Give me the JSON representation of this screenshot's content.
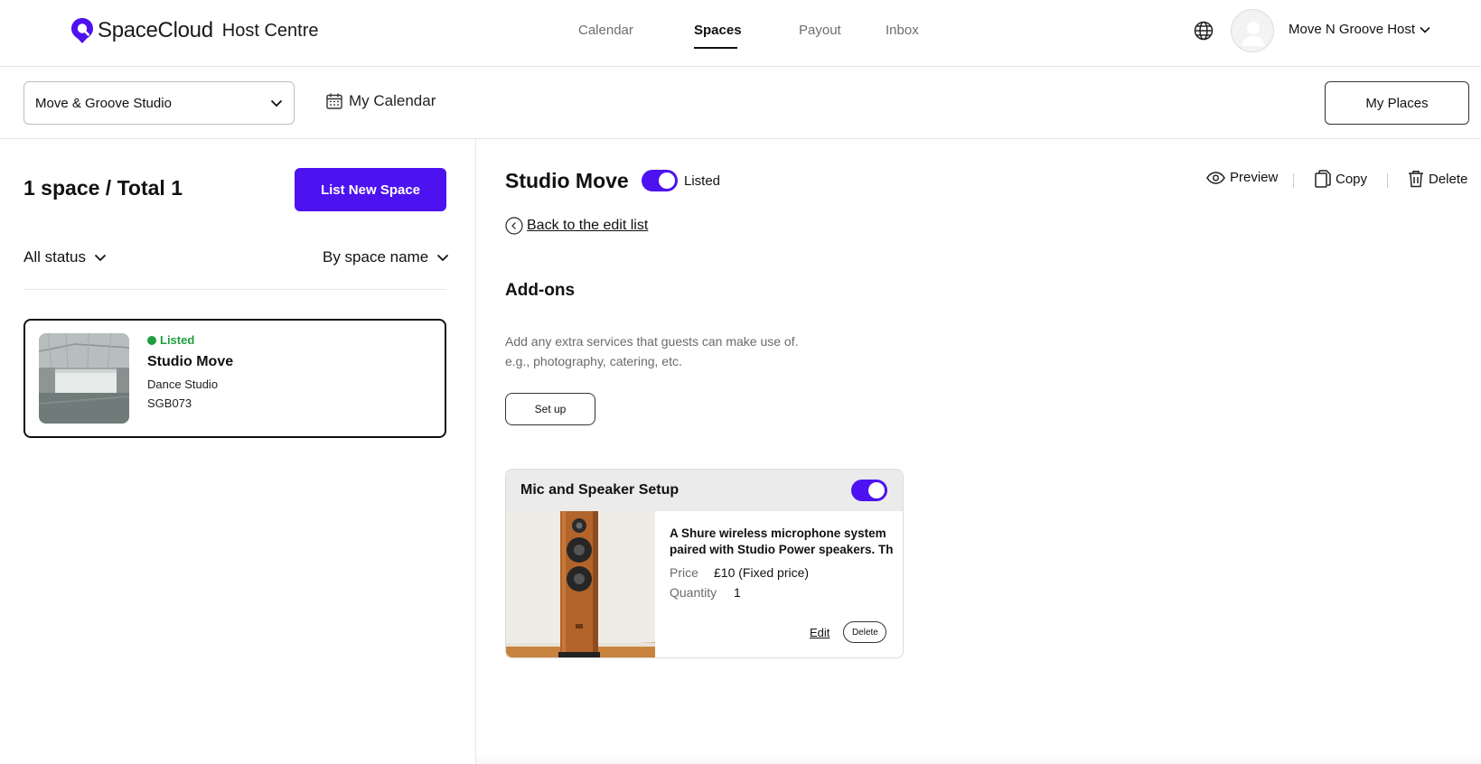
{
  "brand": {
    "name": "SpaceCloud",
    "section": "Host Centre",
    "accent": "#4d12f0",
    "icon": "location-pin-logo"
  },
  "nav": {
    "tabs": [
      {
        "label": "Calendar",
        "active": false
      },
      {
        "label": "Spaces",
        "active": true
      },
      {
        "label": "Payout",
        "active": false
      },
      {
        "label": "Inbox",
        "active": false
      }
    ],
    "language_icon": "globe-icon",
    "user_name": "Move N Groove Host"
  },
  "subbar": {
    "space_select_value": "Move & Groove Studio",
    "calendar_label": "My Calendar",
    "my_places_label": "My Places"
  },
  "left": {
    "count_label": "1 space / Total 1",
    "list_new_label": "List New Space",
    "status_filter": "All status",
    "sort_filter": "By space name",
    "spaces": [
      {
        "status": "Listed",
        "status_color": "#1f9e3d",
        "name": "Studio Move",
        "type": "Dance Studio",
        "code": "SGB073"
      }
    ]
  },
  "detail": {
    "title": "Studio Move",
    "listed": true,
    "listed_label": "Listed",
    "actions": {
      "preview": "Preview",
      "copy": "Copy",
      "delete": "Delete"
    },
    "back_label": "Back to the edit list",
    "addons": {
      "title": "Add-ons",
      "desc_line1": "Add any extra services that guests can make use of.",
      "desc_line2": "e.g., photography, catering, etc.",
      "setup_label": "Set up",
      "items": [
        {
          "name": "Mic and Speaker Setup",
          "enabled": true,
          "description": "A Shure wireless microphone system paired with Studio Power speakers. Th",
          "price_label": "Price",
          "price_value": "£10 (Fixed price)",
          "quantity_label": "Quantity",
          "quantity_value": "1",
          "edit_label": "Edit",
          "delete_label": "Delete"
        }
      ]
    }
  }
}
